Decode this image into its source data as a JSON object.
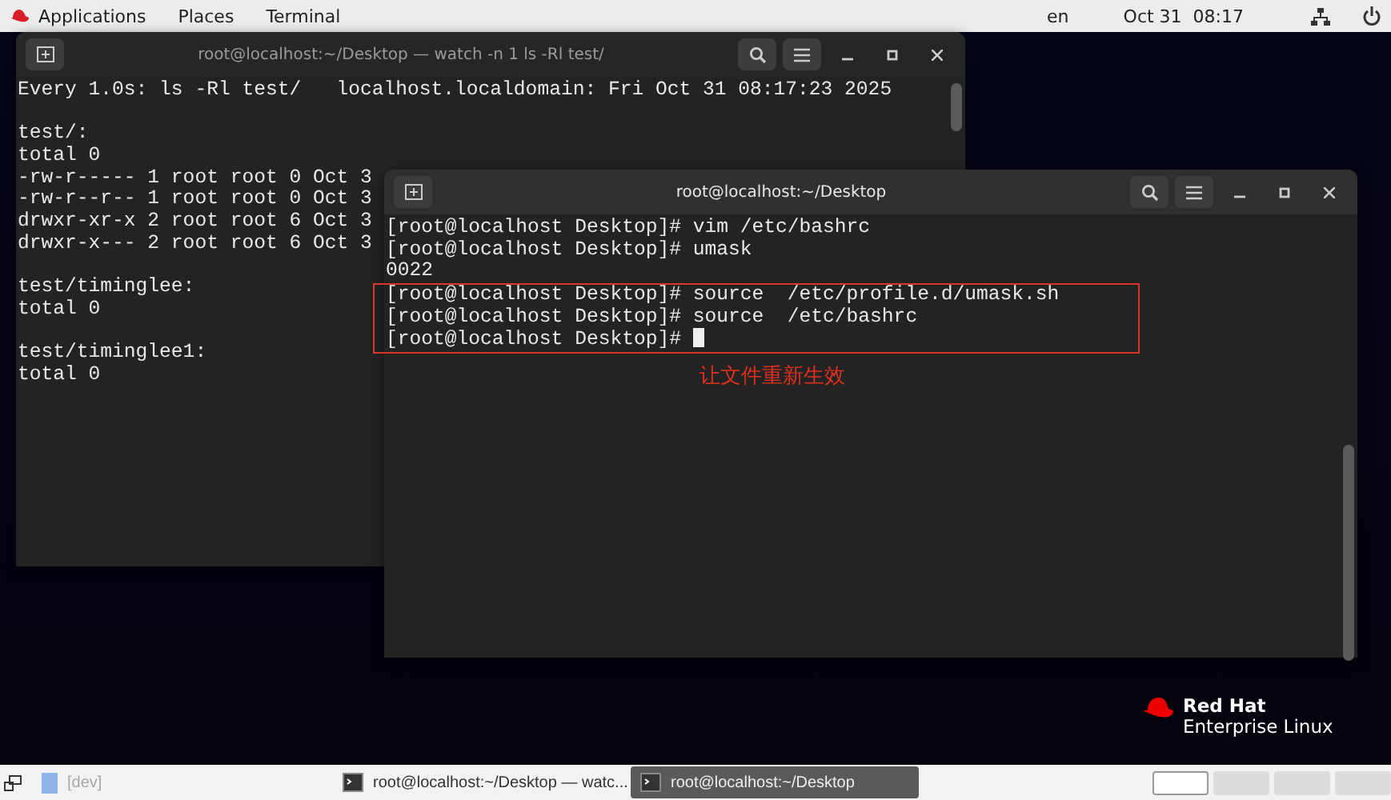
{
  "top_bar": {
    "menus": [
      "Applications",
      "Places",
      "Terminal"
    ],
    "language": "en",
    "clock": "Oct 31  08:17"
  },
  "windows": [
    {
      "title": "root@localhost:~/Desktop — watch -n 1 ls -Rl test/",
      "selected": false,
      "blocks": [
        [
          "Every 1.0s: ls -Rl test/   localhost.localdomain: Fri Oct 31 08:17:23 2025"
        ],
        [
          "test/:",
          "total 0",
          "-rw-r----- 1 root root 0 Oct 3",
          "-rw-r--r-- 1 root root 0 Oct 3",
          "drwxr-xr-x 2 root root 6 Oct 3",
          "drwxr-x--- 2 root root 6 Oct 3"
        ],
        [
          "test/timinglee:",
          "total 0"
        ],
        [
          "test/timinglee1:",
          "total 0"
        ]
      ]
    },
    {
      "title": "root@localhost:~/Desktop",
      "selected": true,
      "cursor": true,
      "annotation": "让文件重新生效",
      "blocks": [
        [
          "[root@localhost Desktop]# vim /etc/bashrc",
          "[root@localhost Desktop]# umask",
          "0022"
        ]
      ],
      "highlighted": [
        "[root@localhost Desktop]# source  /etc/profile.d/umask.sh",
        "[root@localhost Desktop]# source  /etc/bashrc",
        "[root@localhost Desktop]# "
      ]
    }
  ],
  "logo": {
    "brand": "Red Hat",
    "product": "Enterprise Linux"
  },
  "taskbar": {
    "items": [
      {
        "label": "[dev]",
        "kind": "launcher",
        "selected": false
      },
      {
        "label": "root@localhost:~/Desktop — watc...",
        "kind": "window",
        "selected": false
      },
      {
        "label": "root@localhost:~/Desktop",
        "kind": "window",
        "selected": true
      }
    ],
    "workspaces": [
      {
        "selected": true
      },
      {
        "selected": false
      },
      {
        "selected": false
      },
      {
        "selected": false
      }
    ]
  }
}
